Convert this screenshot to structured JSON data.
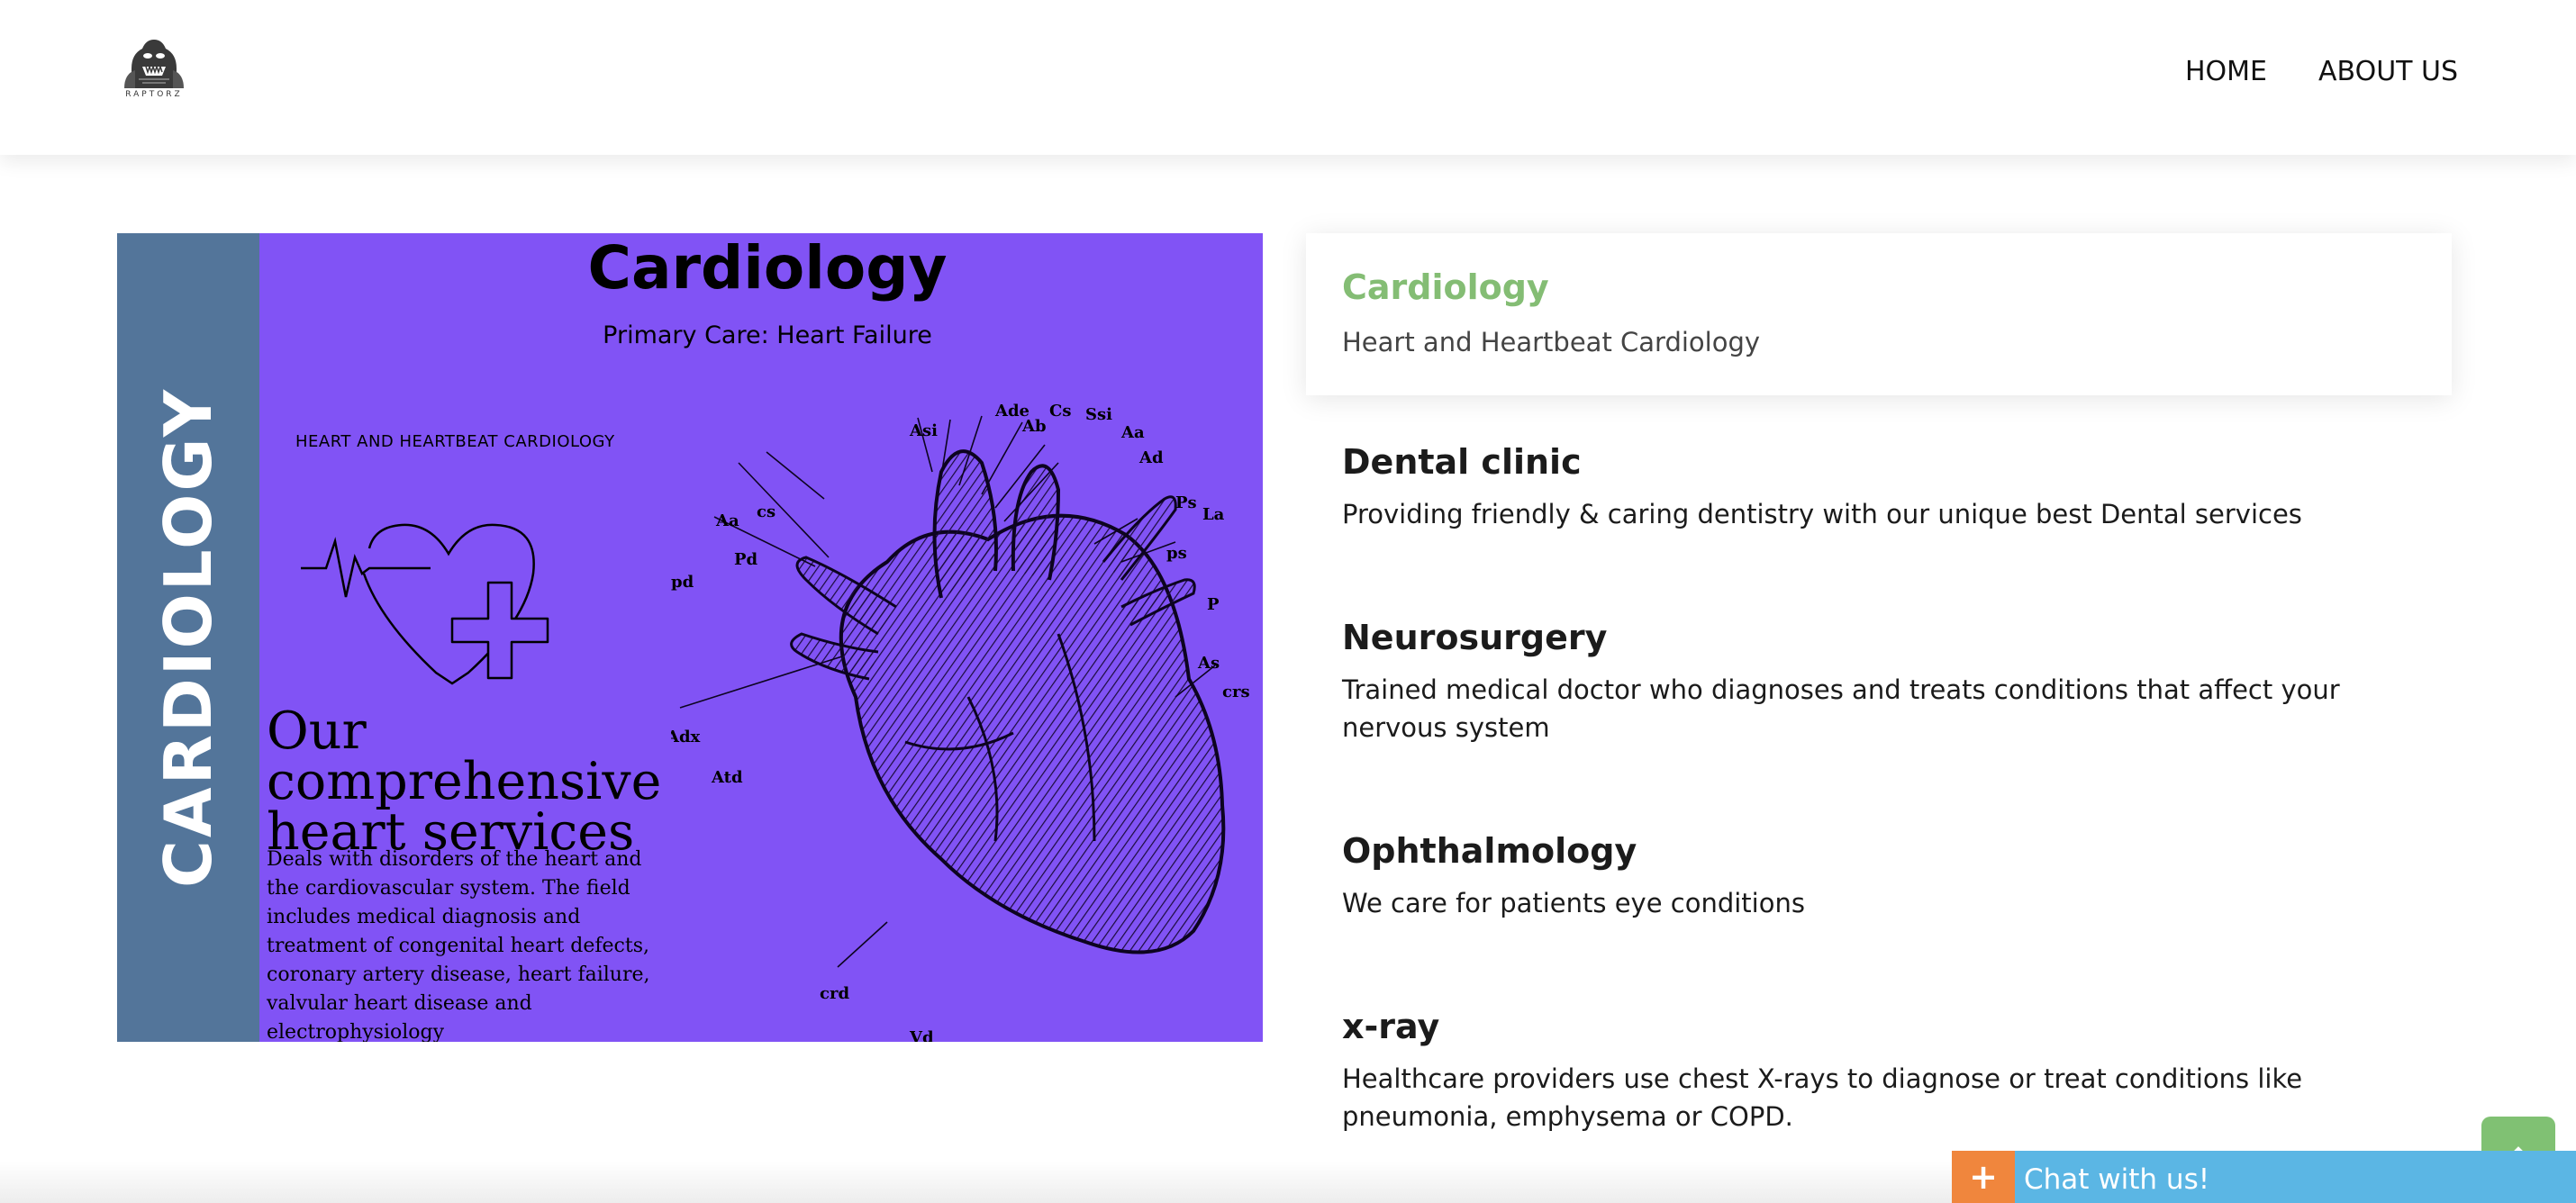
{
  "header": {
    "logo_text": "RAPTORZ",
    "nav": {
      "home": "HOME",
      "about": "ABOUT US"
    }
  },
  "banner": {
    "side_label": "CARDIOLOGY",
    "title": "Cardiology",
    "subtitle": "Primary Care: Heart Failure",
    "caps_label": "HEART AND HEARTBEAT CARDIOLOGY",
    "heading": "Our comprehensive heart services",
    "description": "Deals with disorders of the heart and the cardiovascular system. The field includes medical diagnosis and treatment of congenital heart defects, coronary artery disease, heart failure, valvular heart disease and electrophysiology",
    "organ_labels": [
      "Asi",
      "Ade",
      "Ab",
      "Cs",
      "Ssi",
      "Aa",
      "Ad",
      "Ps",
      "La",
      "ps",
      "P",
      "As",
      "crs",
      "Aa",
      "cs",
      "Pd",
      "pd",
      "Adx",
      "Atd",
      "crd",
      "Vd"
    ]
  },
  "services": {
    "active": {
      "title": "Cardiology",
      "desc": "Heart and Heartbeat Cardiology"
    },
    "items": [
      {
        "title": "Dental clinic",
        "desc": "Providing friendly & caring dentistry with our unique best Dental services"
      },
      {
        "title": "Neurosurgery",
        "desc": "Trained medical doctor who diagnoses and treats conditions that affect your nervous system"
      },
      {
        "title": "Ophthalmology",
        "desc": "We care for patients eye conditions"
      },
      {
        "title": "x-ray",
        "desc": "Healthcare providers use chest X-rays to diagnose or treat conditions like pneumonia, emphysema or COPD."
      }
    ]
  },
  "chat": {
    "icon": "plus-icon",
    "label": "Chat with us!"
  },
  "scroll_top": {
    "icon": "chevron-up-icon"
  },
  "colors": {
    "banner": "#8153f5",
    "strip": "#53759a",
    "accent": "#84bd74",
    "chat": "#5bb6e4",
    "chat_icon": "#f0863d"
  }
}
